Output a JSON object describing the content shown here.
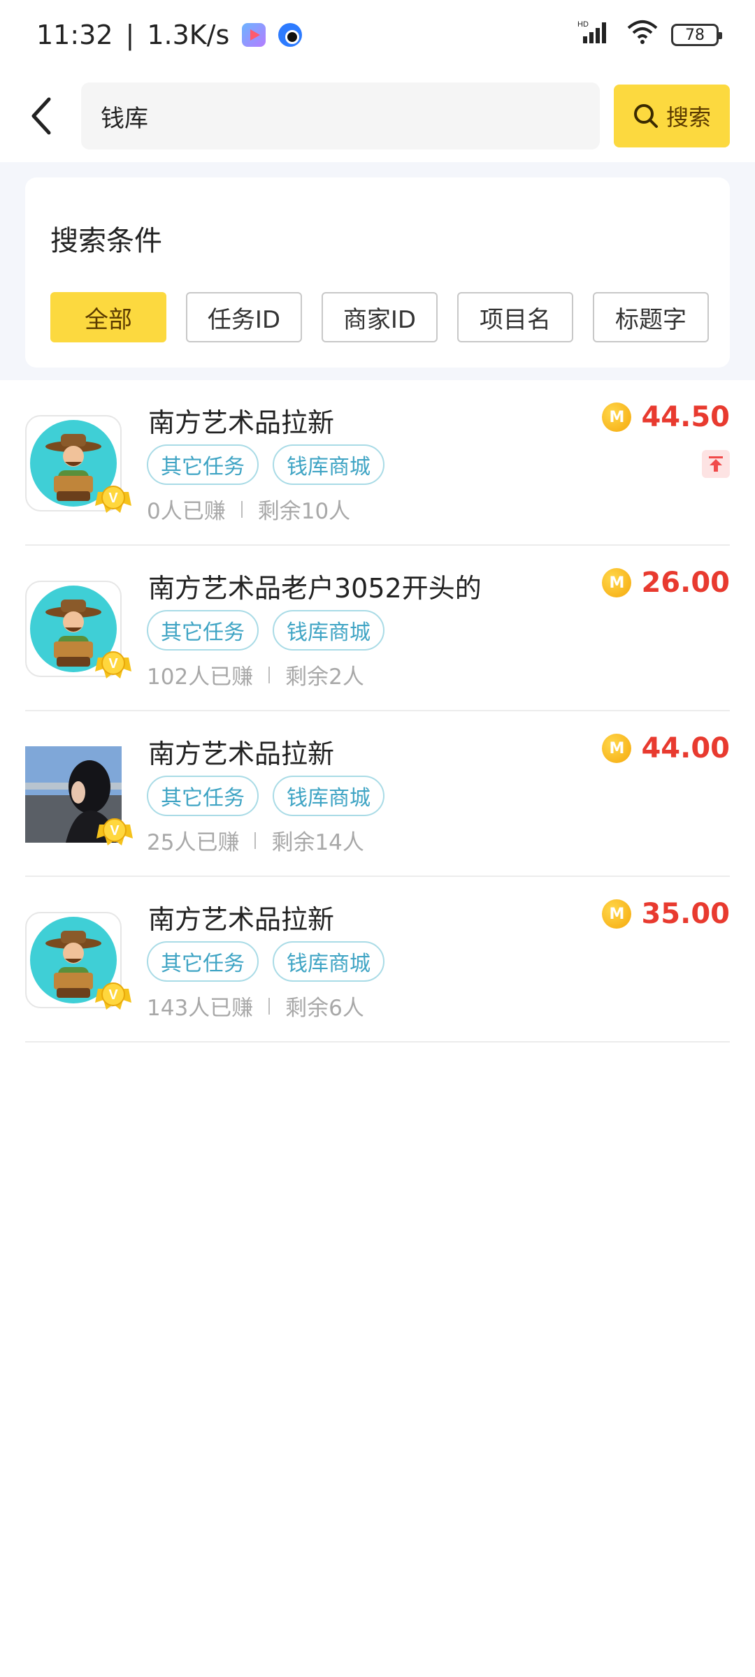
{
  "status_bar": {
    "time": "11:32",
    "speed": "1.3K/s",
    "network": "HD",
    "battery": "78"
  },
  "search": {
    "query": "钱库",
    "button_label": "搜索"
  },
  "filters": {
    "title": "搜索条件",
    "options": [
      "全部",
      "任务ID",
      "商家ID",
      "项目名",
      "标题字"
    ],
    "selected": "全部"
  },
  "tasks": [
    {
      "title": "南方艺术品拉新",
      "tags": [
        "其它任务",
        "钱库商城"
      ],
      "earned": "0人已赚",
      "remaining": "剩余10人",
      "price": "44.50",
      "avatar": "farmer",
      "pinned": true
    },
    {
      "title": "南方艺术品老户3052开头的",
      "tags": [
        "其它任务",
        "钱库商城"
      ],
      "earned": "102人已赚",
      "remaining": "剩余2人",
      "price": "26.00",
      "avatar": "farmer",
      "pinned": false
    },
    {
      "title": "南方艺术品拉新",
      "tags": [
        "其它任务",
        "钱库商城"
      ],
      "earned": "25人已赚",
      "remaining": "剩余14人",
      "price": "44.00",
      "avatar": "photo",
      "pinned": false
    },
    {
      "title": "南方艺术品拉新",
      "tags": [
        "其它任务",
        "钱库商城"
      ],
      "earned": "143人已赚",
      "remaining": "剩余6人",
      "price": "35.00",
      "avatar": "farmer",
      "pinned": false
    }
  ],
  "colors": {
    "accent": "#fcd93f",
    "price": "#e83a2f",
    "tag": "#3fa4c4"
  }
}
